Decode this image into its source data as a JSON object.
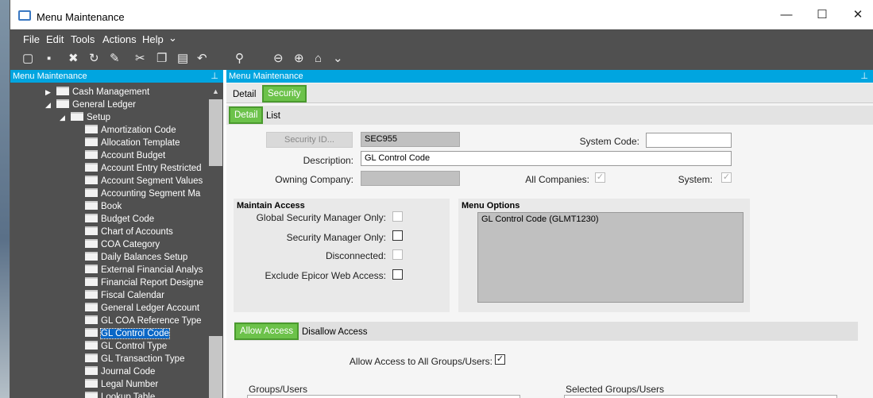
{
  "window": {
    "title": "Menu Maintenance",
    "minimize": "—",
    "maximize": "☐",
    "close": "✕"
  },
  "menubar": [
    "File",
    "Edit",
    "Tools",
    "Actions",
    "Help"
  ],
  "toolbar_glyphs": {
    "new": "▢",
    "save": "▪",
    "delete": "✖",
    "refresh": "↻",
    "clear": "✎",
    "cut": "✂",
    "copy": "❐",
    "paste": "▤",
    "undo": "↶",
    "search": "⚲",
    "back": "⊖",
    "forward": "⊕",
    "home": "⌂",
    "dropdown": "⌄"
  },
  "left_panel": {
    "header": "Menu Maintenance",
    "pin": "⊥",
    "tree": [
      {
        "label": "Cash Management",
        "level": 1,
        "type": "collapsed"
      },
      {
        "label": "General Ledger",
        "level": 1,
        "type": "expanded"
      },
      {
        "label": "Setup",
        "level": 2,
        "type": "expanded"
      },
      {
        "label": "Amortization Code",
        "level": 3
      },
      {
        "label": "Allocation Template",
        "level": 3
      },
      {
        "label": "Account Budget",
        "level": 3
      },
      {
        "label": "Account Entry Restricted",
        "level": 3
      },
      {
        "label": "Account Segment Values",
        "level": 3
      },
      {
        "label": "Accounting Segment Ma",
        "level": 3
      },
      {
        "label": "Book",
        "level": 3
      },
      {
        "label": "Budget Code",
        "level": 3
      },
      {
        "label": "Chart of Accounts",
        "level": 3
      },
      {
        "label": "COA Category",
        "level": 3
      },
      {
        "label": "Daily Balances Setup",
        "level": 3
      },
      {
        "label": "External Financial Analys",
        "level": 3
      },
      {
        "label": "Financial Report Designe",
        "level": 3
      },
      {
        "label": "Fiscal Calendar",
        "level": 3
      },
      {
        "label": "General Ledger Account",
        "level": 3
      },
      {
        "label": "GL COA Reference Type",
        "level": 3
      },
      {
        "label": "GL Control Code",
        "level": 3,
        "selected": true
      },
      {
        "label": "GL Control Type",
        "level": 3
      },
      {
        "label": "GL Transaction Type",
        "level": 3
      },
      {
        "label": "Journal Code",
        "level": 3
      },
      {
        "label": "Legal Number",
        "level": 3
      },
      {
        "label": "Lookup Table",
        "level": 3
      }
    ]
  },
  "right_panel": {
    "header": "Menu Maintenance",
    "pin": "⊥",
    "tabs_top": [
      "Detail",
      "Security"
    ],
    "tabs_sub": [
      "Detail",
      "List"
    ],
    "form": {
      "security_id_btn": "Security ID...",
      "security_id_value": "SEC955",
      "system_code_label": "System Code:",
      "system_code_value": "",
      "description_label": "Description:",
      "description_value": "GL Control Code",
      "owning_company_label": "Owning Company:",
      "owning_company_value": "",
      "all_companies_label": "All Companies:",
      "all_companies_check": "✓",
      "system_label": "System:",
      "system_check": "✓"
    },
    "maintain_access": {
      "title": "Maintain Access",
      "global": "Global Security Manager Only:",
      "secmgr": "Security Manager Only:",
      "disconnected": "Disconnected:",
      "exclude": "Exclude Epicor Web Access:"
    },
    "menu_options": {
      "title": "Menu Options",
      "item": "GL Control Code (GLMT1230)"
    },
    "access_tabs": [
      "Allow Access",
      "Disallow Access"
    ],
    "allow_all_label": "Allow Access to All Groups/Users:",
    "allow_all_check": "✓",
    "groups_label": "Groups/Users",
    "selected_label": "Selected Groups/Users"
  }
}
